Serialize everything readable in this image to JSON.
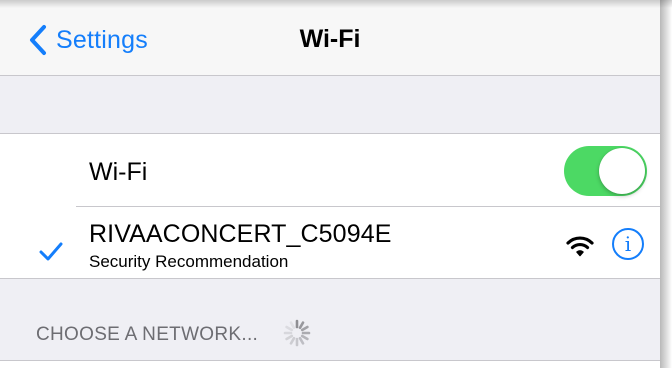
{
  "nav": {
    "back_label": "Settings",
    "title": "Wi-Fi"
  },
  "wifi_toggle": {
    "label": "Wi-Fi",
    "on": true
  },
  "connected_network": {
    "name": "RIVAACONCERT_C5094E",
    "subtitle": "Security Recommendation",
    "connected": true,
    "signal_icon": "wifi-signal-icon",
    "info_glyph": "i"
  },
  "choose_section": {
    "header": "CHOOSE A NETWORK...",
    "loading_icon": "activity-spinner-icon"
  },
  "colors": {
    "accent": "#147efb",
    "toggle_on": "#4cd964",
    "background": "#efeff4",
    "header_text": "#6d6d72"
  }
}
